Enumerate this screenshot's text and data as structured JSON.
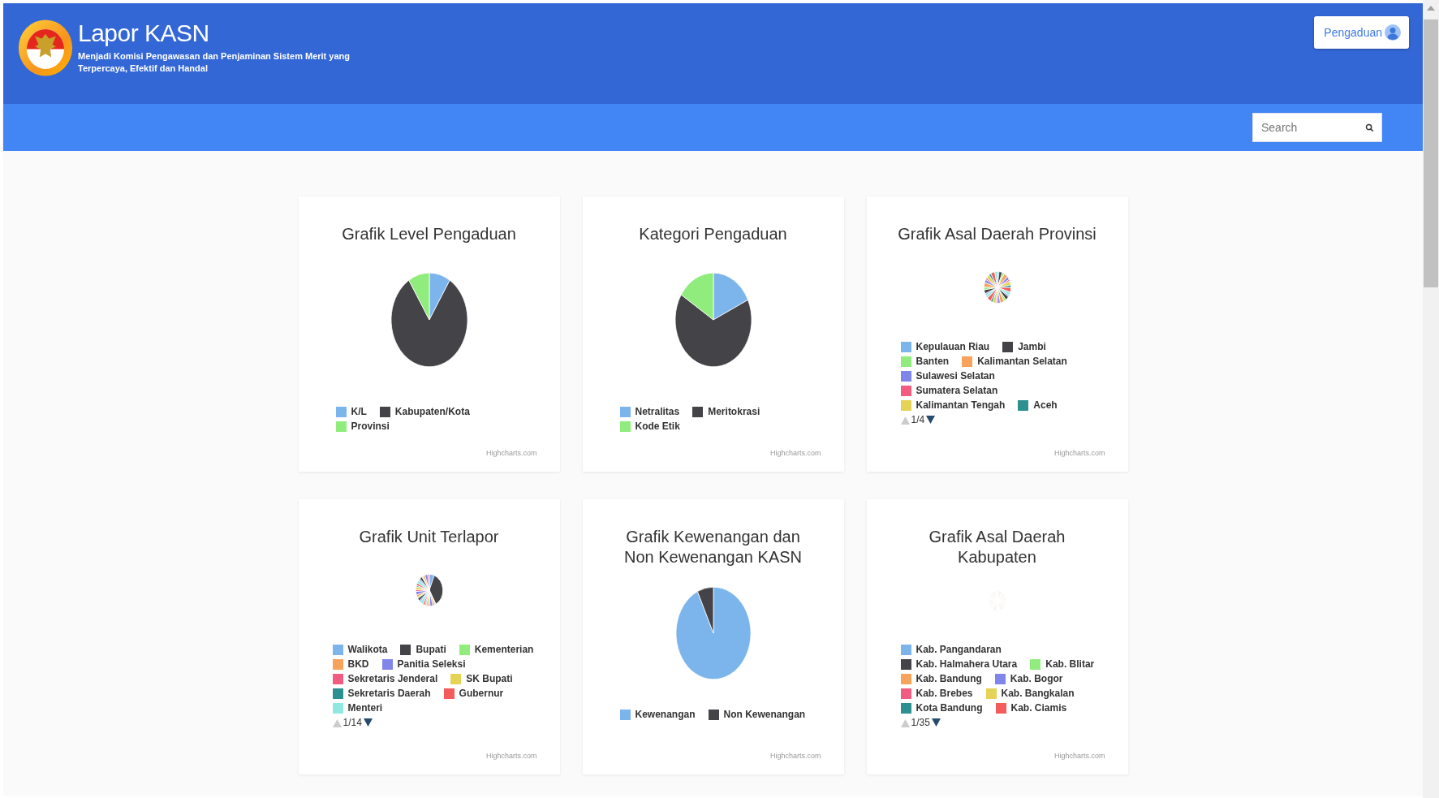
{
  "header": {
    "title": "Lapor KASN",
    "tagline": "Menjadi Komisi Pengawasan dan Penjaminan Sistem Merit yang Terpercaya, Efektif dan Handal",
    "button": "Pengaduan"
  },
  "search": {
    "placeholder": "Search"
  },
  "cards": [
    {
      "title": "Grafik Level Pengaduan",
      "legend": [
        {
          "label": "K/L",
          "color": "#7cb5ec"
        },
        {
          "label": "Kabupaten/Kota",
          "color": "#434348"
        },
        {
          "label": "Provinsi",
          "color": "#90ed7d"
        }
      ],
      "credit": "Highcharts.com"
    },
    {
      "title": "Kategori Pengaduan",
      "legend": [
        {
          "label": "Netralitas",
          "color": "#7cb5ec"
        },
        {
          "label": "Meritokrasi",
          "color": "#434348"
        },
        {
          "label": "Kode Etik",
          "color": "#90ed7d"
        }
      ],
      "credit": "Highcharts.com"
    },
    {
      "title": "Grafik Asal Daerah Provinsi",
      "legend": [
        {
          "label": "Kepulauan Riau",
          "color": "#7cb5ec"
        },
        {
          "label": "Jambi",
          "color": "#434348"
        },
        {
          "label": "Banten",
          "color": "#90ed7d"
        },
        {
          "label": "Kalimantan Selatan",
          "color": "#f7a35c"
        },
        {
          "label": "Sulawesi Selatan",
          "color": "#8085e9"
        },
        {
          "label": "Sumatera Selatan",
          "color": "#f15c80"
        },
        {
          "label": "Kalimantan Tengah",
          "color": "#e4d354"
        },
        {
          "label": "Aceh",
          "color": "#2b908f"
        }
      ],
      "pager": {
        "text": "1/4",
        "up_disabled": true,
        "down_disabled": false
      },
      "credit": "Highcharts.com"
    },
    {
      "title": "Grafik Unit Terlapor",
      "legend": [
        {
          "label": "Walikota",
          "color": "#7cb5ec"
        },
        {
          "label": "Bupati",
          "color": "#434348"
        },
        {
          "label": "Kementerian",
          "color": "#90ed7d"
        },
        {
          "label": "BKD",
          "color": "#f7a35c"
        },
        {
          "label": "Panitia Seleksi",
          "color": "#8085e9"
        },
        {
          "label": "Sekretaris Jenderal",
          "color": "#f15c80"
        },
        {
          "label": "SK Bupati",
          "color": "#e4d354"
        },
        {
          "label": "Sekretaris Daerah",
          "color": "#2b908f"
        },
        {
          "label": "Gubernur",
          "color": "#f45b5b"
        },
        {
          "label": "Menteri",
          "color": "#91e8e1"
        }
      ],
      "pager": {
        "text": "1/14",
        "up_disabled": true,
        "down_disabled": false
      },
      "credit": "Highcharts.com"
    },
    {
      "title": "Grafik Kewenangan dan\nNon Kewenangan KASN",
      "legend": [
        {
          "label": "Kewenangan",
          "color": "#7cb5ec"
        },
        {
          "label": "Non Kewenangan",
          "color": "#434348"
        }
      ],
      "credit": "Highcharts.com"
    },
    {
      "title": "Grafik Asal Daerah\nKabupaten",
      "legend": [
        {
          "label": "Kab. Pangandaran",
          "color": "#7cb5ec"
        },
        {
          "label": "Kab. Halmahera Utara",
          "color": "#434348"
        },
        {
          "label": "Kab. Blitar",
          "color": "#90ed7d"
        },
        {
          "label": "Kab. Bandung",
          "color": "#f7a35c"
        },
        {
          "label": "Kab. Bogor",
          "color": "#8085e9"
        },
        {
          "label": "Kab. Brebes",
          "color": "#f15c80"
        },
        {
          "label": "Kab. Bangkalan",
          "color": "#e4d354"
        },
        {
          "label": "Kota Bandung",
          "color": "#2b908f"
        },
        {
          "label": "Kab. Ciamis",
          "color": "#f45b5b"
        }
      ],
      "pager": {
        "text": "1/35",
        "up_disabled": true,
        "down_disabled": false
      },
      "credit": "Highcharts.com"
    }
  ]
}
